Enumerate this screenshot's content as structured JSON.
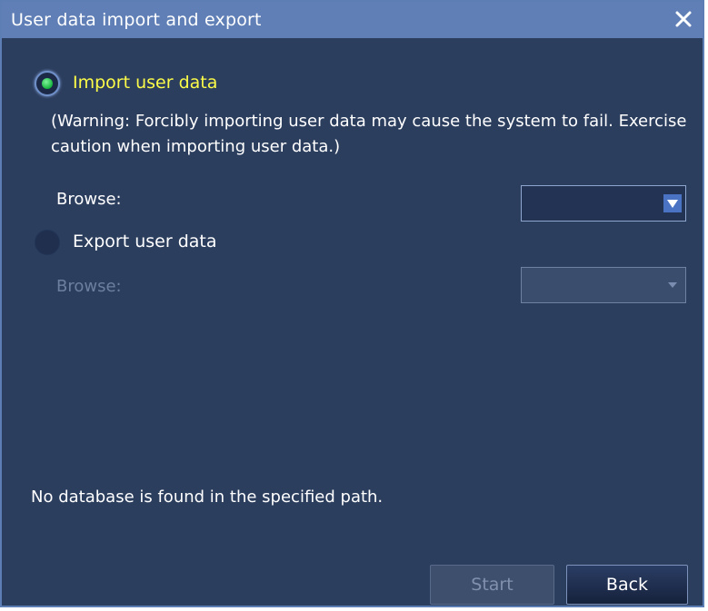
{
  "dialog": {
    "title": "User data import and export",
    "close_icon": "close-icon"
  },
  "import_option": {
    "label": "Import user data",
    "selected": true,
    "warning": "(Warning: Forcibly importing user data may cause the system to fail. Exercise caution when importing user data.)",
    "browse_label": "Browse:",
    "browse_value": "",
    "enabled": true
  },
  "export_option": {
    "label": "Export user data",
    "selected": false,
    "browse_label": "Browse:",
    "browse_value": "",
    "enabled": false
  },
  "status_message": "No database is found in the specified path.",
  "buttons": {
    "start": "Start",
    "back": "Back"
  },
  "colors": {
    "background": "#2c3e5e",
    "titlebar": "#5f7fb6",
    "active_label": "#fbfb48",
    "radio_selected_dot": "#16b53e",
    "disabled_text": "#6d7f9f"
  }
}
